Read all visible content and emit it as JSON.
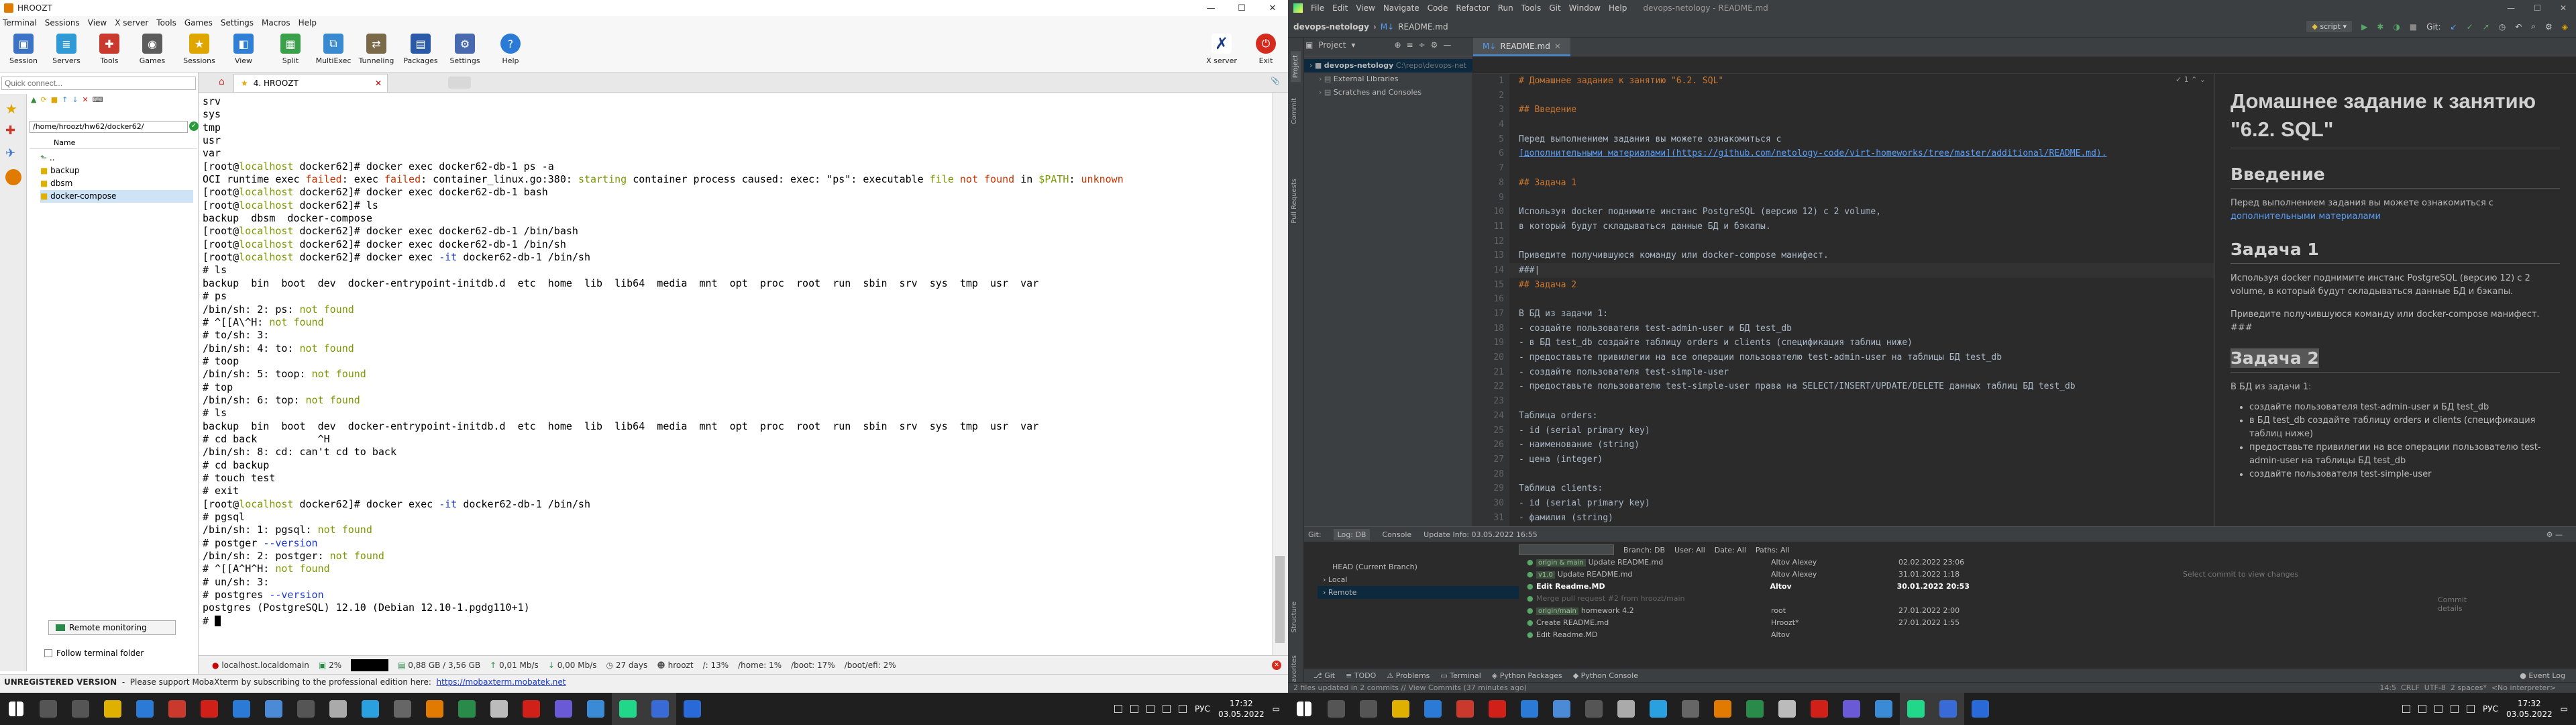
{
  "moba": {
    "title": "HROOZT",
    "menu": [
      "Terminal",
      "Sessions",
      "View",
      "X server",
      "Tools",
      "Games",
      "Settings",
      "Macros",
      "Help"
    ],
    "toolbar": [
      "Session",
      "Servers",
      "Tools",
      "Games",
      "Sessions",
      "View",
      "Split",
      "MultiExec",
      "Tunneling",
      "Packages",
      "Settings",
      "Help"
    ],
    "xserver_label": "X server",
    "exit_label": "Exit",
    "quick_connect_placeholder": "Quick connect...",
    "session_tab": "4. HROOZT",
    "path": "/home/hroozt/hw62/docker62/",
    "tree_header": "Name",
    "tree": [
      "..",
      "backup",
      "dbsm",
      "docker-compose"
    ],
    "remote_monitoring": "Remote monitoring",
    "follow_folder": "Follow terminal folder",
    "status": {
      "host": "localhost.localdomain",
      "cpu": "2%",
      "mem": "0,88 GB / 3,56 GB",
      "up": "0,01 Mb/s",
      "down": "0,00 Mb/s",
      "uptime": "27 days",
      "user": "hroozt",
      "root": "/: 13%",
      "home": "/home: 1%",
      "boot": "/boot: 17%",
      "bootefi": "/boot/efi: 2%"
    },
    "unregistered": "UNREGISTERED VERSION",
    "unreg_msg": "  -  Please support MobaXterm by subscribing to the professional edition here:  ",
    "unreg_link": "https://mobaxterm.mobatek.net"
  },
  "terminal": {
    "lines": [
      [
        {
          "t": "srv"
        }
      ],
      [
        {
          "t": "sys"
        }
      ],
      [
        {
          "t": "tmp"
        }
      ],
      [
        {
          "t": "usr"
        }
      ],
      [
        {
          "t": "var"
        }
      ],
      [
        {
          "t": "[root@"
        },
        {
          "t": "localhost",
          "c": "grn"
        },
        {
          "t": " docker62]# docker exec docker62-db-1 ps -a"
        }
      ],
      [
        {
          "t": "OCI runtime exec "
        },
        {
          "t": "failed",
          "c": "red"
        },
        {
          "t": ": exec "
        },
        {
          "t": "failed",
          "c": "red"
        },
        {
          "t": ": container_linux.go:380: "
        },
        {
          "t": "starting",
          "c": "grn"
        },
        {
          "t": " container process caused: exec: \"ps\": executable "
        },
        {
          "t": "file",
          "c": "grn"
        },
        {
          "t": " "
        },
        {
          "t": "not found",
          "c": "red"
        },
        {
          "t": " in "
        },
        {
          "t": "$PATH",
          "c": "grn"
        },
        {
          "t": ": "
        },
        {
          "t": "unknown",
          "c": "red"
        }
      ],
      [
        {
          "t": "[root@"
        },
        {
          "t": "localhost",
          "c": "grn"
        },
        {
          "t": " docker62]# docker exec docker62-db-1 bash"
        }
      ],
      [
        {
          "t": "[root@"
        },
        {
          "t": "localhost",
          "c": "grn"
        },
        {
          "t": " docker62]# ls"
        }
      ],
      [
        {
          "t": "backup  dbsm  docker-compose"
        }
      ],
      [
        {
          "t": "[root@"
        },
        {
          "t": "localhost",
          "c": "grn"
        },
        {
          "t": " docker62]# docker exec docker62-db-1 /bin/bash"
        }
      ],
      [
        {
          "t": "[root@"
        },
        {
          "t": "localhost",
          "c": "grn"
        },
        {
          "t": " docker62]# docker exec docker62-db-1 /bin/sh"
        }
      ],
      [
        {
          "t": "[root@"
        },
        {
          "t": "localhost",
          "c": "grn"
        },
        {
          "t": " docker62]# docker exec "
        },
        {
          "t": "-it",
          "c": "blu"
        },
        {
          "t": " docker62-db-1 /bin/sh"
        }
      ],
      [
        {
          "t": "# ls"
        }
      ],
      [
        {
          "t": "backup  bin  boot  dev  docker-entrypoint-initdb.d  etc  home  lib  lib64  media  mnt  opt  proc  root  run  sbin  srv  sys  tmp  usr  var"
        }
      ],
      [
        {
          "t": "# ps"
        }
      ],
      [
        {
          "t": "/bin/sh: 2: ps: "
        },
        {
          "t": "not found",
          "c": "grn"
        }
      ],
      [
        {
          "t": "# ^[[A\\^H: "
        },
        {
          "t": "not found",
          "c": "grn"
        }
      ],
      [
        {
          "t": "# to/sh: 3:"
        }
      ],
      [
        {
          "t": "/bin/sh: 4: to: "
        },
        {
          "t": "not found",
          "c": "grn"
        }
      ],
      [
        {
          "t": "# toop"
        }
      ],
      [
        {
          "t": "/bin/sh: 5: toop: "
        },
        {
          "t": "not found",
          "c": "grn"
        }
      ],
      [
        {
          "t": "# top"
        }
      ],
      [
        {
          "t": "/bin/sh: 6: top: "
        },
        {
          "t": "not found",
          "c": "grn"
        }
      ],
      [
        {
          "t": "# ls"
        }
      ],
      [
        {
          "t": "backup  bin  boot  dev  docker-entrypoint-initdb.d  etc  home  lib  lib64  media  mnt  opt  proc  root  run  sbin  srv  sys  tmp  usr  var"
        }
      ],
      [
        {
          "t": "# cd back          ^H"
        }
      ],
      [
        {
          "t": "/bin/sh: 8: cd: can't cd to back"
        }
      ],
      [
        {
          "t": "# cd backup"
        }
      ],
      [
        {
          "t": "# touch test"
        }
      ],
      [
        {
          "t": "# exit"
        }
      ],
      [
        {
          "t": "[root@"
        },
        {
          "t": "localhost",
          "c": "grn"
        },
        {
          "t": " docker62]# docker exec "
        },
        {
          "t": "-it",
          "c": "blu"
        },
        {
          "t": " docker62-db-1 /bin/sh"
        }
      ],
      [
        {
          "t": "# pgsql"
        }
      ],
      [
        {
          "t": "/bin/sh: 1: pgsql: "
        },
        {
          "t": "not found",
          "c": "grn"
        }
      ],
      [
        {
          "t": "# postger "
        },
        {
          "t": "--version",
          "c": "blu"
        }
      ],
      [
        {
          "t": "/bin/sh: 2: postger: "
        },
        {
          "t": "not found",
          "c": "grn"
        }
      ],
      [
        {
          "t": "# ^[[A^H^H: "
        },
        {
          "t": "not found",
          "c": "grn"
        }
      ],
      [
        {
          "t": "# un/sh: 3:"
        }
      ],
      [
        {
          "t": "# postgres "
        },
        {
          "t": "--version",
          "c": "blu"
        }
      ],
      [
        {
          "t": "postgres (PostgreSQL) 12.10 (Debian 12.10-1.pgdg110+1)"
        }
      ],
      [
        {
          "t": "# "
        }
      ]
    ]
  },
  "ide": {
    "menu": [
      "File",
      "Edit",
      "View",
      "Navigate",
      "Code",
      "Refactor",
      "Run",
      "Tools",
      "Git",
      "Window",
      "Help"
    ],
    "window_title": "devops-netology - README.md",
    "breadcrumb_project": "devops-netology",
    "breadcrumb_file": "README.md",
    "project_label": "Project",
    "file_tab": "README.md",
    "run_config": "script",
    "git_label": "Git:",
    "project_tree": [
      {
        "t": "devops-netology",
        "sub": "C:\\repo\\devops-net",
        "bold": true
      },
      {
        "t": "External Libraries"
      },
      {
        "t": "Scratches and Consoles"
      }
    ],
    "editor_lines": [
      {
        "n": "1",
        "t": "# Домашнее задание к занятию \"6.2. SQL\"",
        "k": "h"
      },
      {
        "n": "2",
        "t": ""
      },
      {
        "n": "3",
        "t": "## Введение",
        "k": "h"
      },
      {
        "n": "4",
        "t": ""
      },
      {
        "n": "5",
        "t": "Перед выполнением задания вы можете ознакомиться с"
      },
      {
        "n": "6",
        "t": "[дополнительными материалами](https://github.com/netology-code/virt-homeworks/tree/master/additional/README.md).",
        "k": "l"
      },
      {
        "n": "7",
        "t": ""
      },
      {
        "n": "8",
        "t": "## Задача 1",
        "k": "h"
      },
      {
        "n": "9",
        "t": ""
      },
      {
        "n": "10",
        "t": "Используя docker поднимите инстанс PostgreSQL (версию 12) c 2 volume,"
      },
      {
        "n": "11",
        "t": "в который будут складываться данные БД и бэкапы."
      },
      {
        "n": "12",
        "t": ""
      },
      {
        "n": "13",
        "t": "Приведите получившуюся команду или docker-compose манифест."
      },
      {
        "n": "14",
        "t": "###|",
        "k": "c"
      },
      {
        "n": "15",
        "t": "## Задача 2",
        "k": "h"
      },
      {
        "n": "16",
        "t": ""
      },
      {
        "n": "17",
        "t": "В БД из задачи 1:"
      },
      {
        "n": "18",
        "t": "- создайте пользователя test-admin-user и БД test_db"
      },
      {
        "n": "19",
        "t": "- в БД test_db создайте таблицу orders и clients (спецификация таблиц ниже)"
      },
      {
        "n": "20",
        "t": "- предоставьте привилегии на все операции пользователю test-admin-user на таблицы БД test_db"
      },
      {
        "n": "21",
        "t": "- создайте пользователя test-simple-user"
      },
      {
        "n": "22",
        "t": "- предоставьте пользователю test-simple-user права на SELECT/INSERT/UPDATE/DELETE данных таблиц БД test_db"
      },
      {
        "n": "23",
        "t": ""
      },
      {
        "n": "24",
        "t": "Таблица orders:"
      },
      {
        "n": "25",
        "t": "- id (serial primary key)"
      },
      {
        "n": "26",
        "t": "- наименование (string)"
      },
      {
        "n": "27",
        "t": "- цена (integer)"
      },
      {
        "n": "28",
        "t": ""
      },
      {
        "n": "29",
        "t": "Таблица clients:"
      },
      {
        "n": "30",
        "t": "- id (serial primary key)"
      },
      {
        "n": "31",
        "t": "- фамилия (string)"
      }
    ],
    "preview": {
      "h1": "Домашнее задание к занятию \"6.2. SQL\"",
      "h2_intro": "Введение",
      "intro_p": "Перед выполнением задания вы можете ознакомиться с",
      "intro_link": "дополнительными материалами",
      "h2_task1": "Задача 1",
      "task1_p1": "Используя docker поднимите инстанс PostgreSQL (версию 12) c 2 volume, в который будут складываться данные БД и бэкапы.",
      "task1_p2": "Приведите получившуюся команду или docker-compose манифест. ###",
      "h2_task2": "Задача 2",
      "task2_p": "В БД из задачи 1:",
      "task2_items": [
        "создайте пользователя test-admin-user и БД test_db",
        "в БД test_db создайте таблицу orders и clients (спецификация таблиц ниже)",
        "предоставьте привилегии на все операции пользователю test-admin-user на таблицы БД test_db",
        "создайте пользователя test-simple-user"
      ]
    },
    "git": {
      "tabs": [
        "Git:",
        "Log: DB",
        "Console"
      ],
      "update_info": "Update Info: 03.05.2022 16:55",
      "head": "HEAD (Current Branch)",
      "local": "Local",
      "remote": "Remote",
      "filter_branch": "Branch: DB",
      "filter_user": "User: All",
      "filter_date": "Date: All",
      "filter_paths": "Paths: All",
      "commits": [
        {
          "tag": "origin & main",
          "msg": "Update README.md",
          "author": "Altov Alexey",
          "date": "02.02.2022 23:06"
        },
        {
          "tag": "v1.0",
          "msg": "Update README.md",
          "author": "Altov Alexey",
          "date": "31.01.2022 1:18"
        },
        {
          "tag": "",
          "msg": "Edit Readme.MD",
          "author": "Altov",
          "date": "30.01.2022 20:53"
        },
        {
          "tag": "",
          "msg": "Merge pull request #2 from hroozt/main",
          "author": "",
          "date": ""
        },
        {
          "tag": "origin/main",
          "msg": "homework 4.2",
          "author": "root",
          "date": "27.01.2022 2:00"
        },
        {
          "tag": "",
          "msg": "Create README.md",
          "author": "Hroozt*",
          "date": "27.01.2022 1:55"
        },
        {
          "tag": "",
          "msg": "Edit Readme.MD",
          "author": "Altov",
          "date": ""
        }
      ],
      "select_hint": "Select commit to view changes",
      "commit_details": "Commit details"
    },
    "bottom_tabs": [
      "Git",
      "TODO",
      "Problems",
      "Terminal",
      "Python Packages",
      "Python Console"
    ],
    "event_log": "Event Log",
    "status_msg": "2 files updated in 2 commits // View Commits (37 minutes ago)",
    "status_right": "14:5  CRLF  UTF-8  2 spaces*  <No interpreter>"
  },
  "taskbar": {
    "lang": "РУС",
    "time1": "17:32",
    "date1": "03.05.2022",
    "time2": "17:32",
    "date2": "03.05.2022"
  },
  "colors": {
    "moba_accent": "#e07a00",
    "term_green": "#7a9a00",
    "term_red": "#cc3300",
    "ide_bg": "#2b2b2b",
    "ide_heading": "#cc7832",
    "ide_link": "#589df6",
    "ide_text": "#a9b7c6"
  }
}
